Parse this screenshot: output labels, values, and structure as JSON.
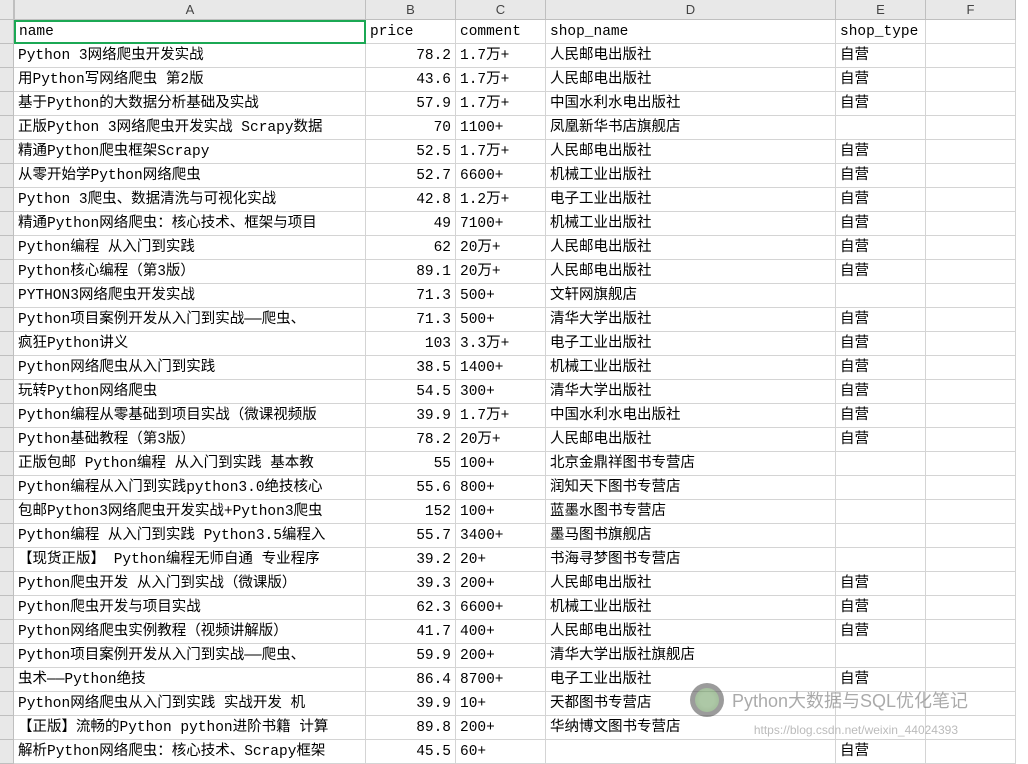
{
  "columns": [
    "A",
    "B",
    "C",
    "D",
    "E",
    "F"
  ],
  "headers": {
    "A": "name",
    "B": "price",
    "C": "comment",
    "D": "shop_name",
    "E": "shop_type",
    "F": ""
  },
  "rows": [
    {
      "name": "Python 3网络爬虫开发实战",
      "price": "78.2",
      "comment": "1.7万+",
      "shop_name": "人民邮电出版社",
      "shop_type": "自营"
    },
    {
      "name": "用Python写网络爬虫 第2版",
      "price": "43.6",
      "comment": "1.7万+",
      "shop_name": "人民邮电出版社",
      "shop_type": "自营"
    },
    {
      "name": "基于Python的大数据分析基础及实战",
      "price": "57.9",
      "comment": "1.7万+",
      "shop_name": "中国水利水电出版社",
      "shop_type": "自营"
    },
    {
      "name": "正版Python 3网络爬虫开发实战 Scrapy数据",
      "price": "70",
      "comment": "1100+",
      "shop_name": "凤凰新华书店旗舰店",
      "shop_type": ""
    },
    {
      "name": "精通Python爬虫框架Scrapy",
      "price": "52.5",
      "comment": "1.7万+",
      "shop_name": "人民邮电出版社",
      "shop_type": "自营"
    },
    {
      "name": "从零开始学Python网络爬虫",
      "price": "52.7",
      "comment": "6600+",
      "shop_name": "机械工业出版社",
      "shop_type": "自营"
    },
    {
      "name": "Python 3爬虫、数据清洗与可视化实战",
      "price": "42.8",
      "comment": "1.2万+",
      "shop_name": "电子工业出版社",
      "shop_type": "自营"
    },
    {
      "name": "精通Python网络爬虫：核心技术、框架与项目",
      "price": "49",
      "comment": "7100+",
      "shop_name": "机械工业出版社",
      "shop_type": "自营"
    },
    {
      "name": "Python编程 从入门到实践",
      "price": "62",
      "comment": "20万+",
      "shop_name": "人民邮电出版社",
      "shop_type": "自营"
    },
    {
      "name": "Python核心编程（第3版）",
      "price": "89.1",
      "comment": "20万+",
      "shop_name": "人民邮电出版社",
      "shop_type": "自营"
    },
    {
      "name": "PYTHON3网络爬虫开发实战",
      "price": "71.3",
      "comment": "500+",
      "shop_name": "文轩网旗舰店",
      "shop_type": ""
    },
    {
      "name": "Python项目案例开发从入门到实战——爬虫、",
      "price": "71.3",
      "comment": "500+",
      "shop_name": "清华大学出版社",
      "shop_type": "自营"
    },
    {
      "name": "疯狂Python讲义",
      "price": "103",
      "comment": "3.3万+",
      "shop_name": "电子工业出版社",
      "shop_type": "自营"
    },
    {
      "name": "Python网络爬虫从入门到实践",
      "price": "38.5",
      "comment": "1400+",
      "shop_name": "机械工业出版社",
      "shop_type": "自营"
    },
    {
      "name": "玩转Python网络爬虫",
      "price": "54.5",
      "comment": "300+",
      "shop_name": "清华大学出版社",
      "shop_type": "自营"
    },
    {
      "name": "Python编程从零基础到项目实战（微课视频版",
      "price": "39.9",
      "comment": "1.7万+",
      "shop_name": "中国水利水电出版社",
      "shop_type": "自营"
    },
    {
      "name": "Python基础教程（第3版）",
      "price": "78.2",
      "comment": "20万+",
      "shop_name": "人民邮电出版社",
      "shop_type": "自营"
    },
    {
      "name": "正版包邮 Python编程 从入门到实践 基本教",
      "price": "55",
      "comment": "100+",
      "shop_name": "北京金鼎祥图书专营店",
      "shop_type": ""
    },
    {
      "name": "Python编程从入门到实践python3.0绝技核心",
      "price": "55.6",
      "comment": "800+",
      "shop_name": "润知天下图书专营店",
      "shop_type": ""
    },
    {
      "name": "包邮Python3网络爬虫开发实战+Python3爬虫",
      "price": "152",
      "comment": "100+",
      "shop_name": "蓝墨水图书专营店",
      "shop_type": ""
    },
    {
      "name": "Python编程 从入门到实践 Python3.5编程入",
      "price": "55.7",
      "comment": "3400+",
      "shop_name": "墨马图书旗舰店",
      "shop_type": ""
    },
    {
      "name": "【现货正版】 Python编程无师自通 专业程序",
      "price": "39.2",
      "comment": "20+",
      "shop_name": "书海寻梦图书专营店",
      "shop_type": ""
    },
    {
      "name": "Python爬虫开发 从入门到实战（微课版）",
      "price": "39.3",
      "comment": "200+",
      "shop_name": "人民邮电出版社",
      "shop_type": "自营"
    },
    {
      "name": "Python爬虫开发与项目实战",
      "price": "62.3",
      "comment": "6600+",
      "shop_name": "机械工业出版社",
      "shop_type": "自营"
    },
    {
      "name": "Python网络爬虫实例教程（视频讲解版）",
      "price": "41.7",
      "comment": "400+",
      "shop_name": "人民邮电出版社",
      "shop_type": "自营"
    },
    {
      "name": "Python项目案例开发从入门到实战——爬虫、",
      "price": "59.9",
      "comment": "200+",
      "shop_name": "清华大学出版社旗舰店",
      "shop_type": ""
    },
    {
      "name": "虫术——Python绝技",
      "price": "86.4",
      "comment": "8700+",
      "shop_name": "电子工业出版社",
      "shop_type": "自营"
    },
    {
      "name": "Python网络爬虫从入门到实践 实战开发 机",
      "price": "39.9",
      "comment": "10+",
      "shop_name": "天都图书专营店",
      "shop_type": ""
    },
    {
      "name": "【正版】流畅的Python python进阶书籍 计算",
      "price": "89.8",
      "comment": "200+",
      "shop_name": "华纳博文图书专营店",
      "shop_type": ""
    },
    {
      "name": "解析Python网络爬虫：核心技术、Scrapy框架",
      "price": "45.5",
      "comment": "60+",
      "shop_name": "",
      "shop_type": "自营"
    }
  ],
  "watermark": {
    "main": "Python大数据与SQL优化笔记",
    "sub": "https://blog.csdn.net/weixin_44024393"
  }
}
